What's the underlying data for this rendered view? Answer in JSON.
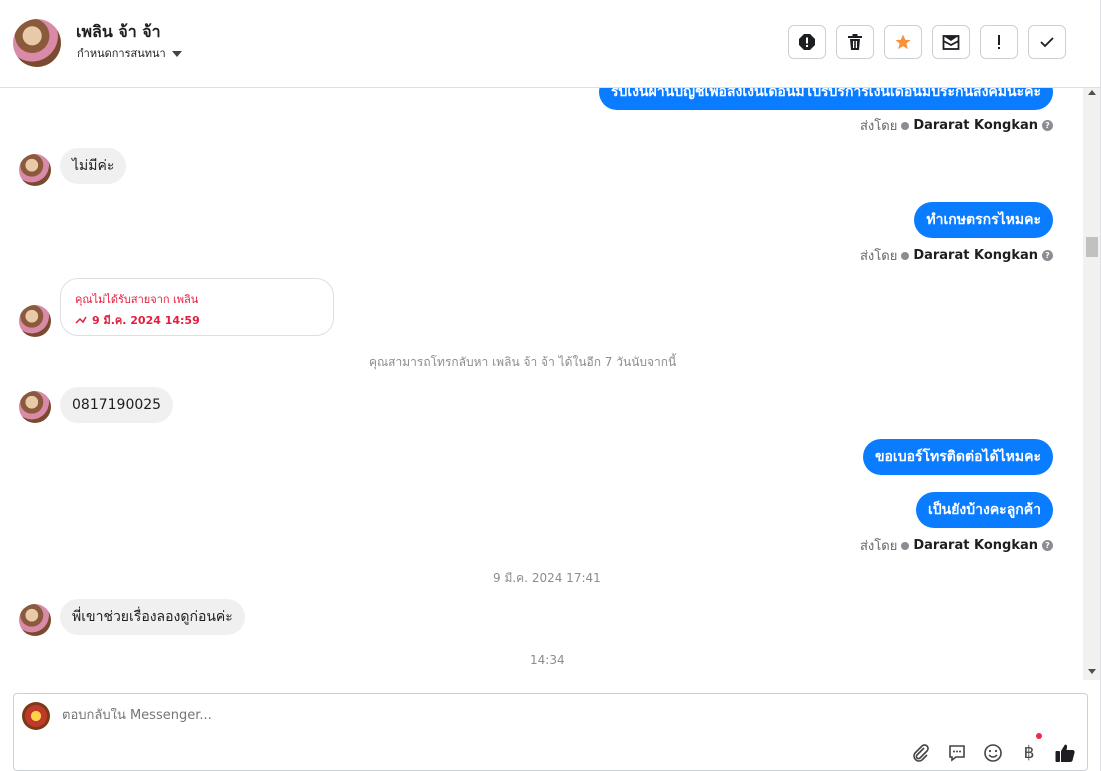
{
  "header": {
    "contact_name": "เพลิน จ้า จ้า",
    "assign_label": "กำหนดการสนทนา",
    "toolbar": [
      {
        "name": "spam-button",
        "icon": "alert-octagon-icon"
      },
      {
        "name": "delete-button",
        "icon": "trash-icon"
      },
      {
        "name": "star-button",
        "icon": "star-icon"
      },
      {
        "name": "mark-unread-button",
        "icon": "envelope-icon"
      },
      {
        "name": "follow-up-button",
        "icon": "exclamation-icon"
      },
      {
        "name": "done-button",
        "icon": "check-icon"
      }
    ]
  },
  "messages": {
    "m0_text": "รับเงินผ่านบัญชีเพื่อส่งเงินเดือนมีโปรบริการเงินเดือนมีประกันสังคมนะคะ",
    "m0_sent_prefix": "ส่งโดย",
    "m0_sent_name": "Dararat Kongkan",
    "m1_text": "ไม่มีค่ะ",
    "m2_text": "ทำเกษตรกรไหมคะ",
    "m2_sent_prefix": "ส่งโดย",
    "m2_sent_name": "Dararat Kongkan",
    "missed_title": "คุณไม่ได้รับสายจาก เพลิน",
    "missed_time": "9 มี.ค. 2024 14:59",
    "callback_notice": "คุณสามารถโทรกลับหา เพลิน จ้า จ้า ได้ในอีก 7 วันนับจากนี้",
    "m3_text": "0817190025",
    "m4_text": "ขอเบอร์โทรติดต่อได้ไหมคะ",
    "m5_text": "เป็นยังบ้างคะลูกค้า",
    "m5_sent_prefix": "ส่งโดย",
    "m5_sent_name": "Dararat Kongkan",
    "timestamp1": "9 มี.ค. 2024 17:41",
    "m6_text": "พี่เขาช่วยเรื่องลองดูก่อนค่ะ",
    "timestamp2": "14:34"
  },
  "composer": {
    "placeholder": "ตอบกลับใน Messenger...",
    "icons": [
      "paperclip-icon",
      "chat-bubble-icon",
      "emoji-icon",
      "baht-icon",
      "thumbs-up-icon"
    ]
  },
  "colors": {
    "accent": "#0a7cff",
    "missed_call": "#e41e3f",
    "star": "#f7923a"
  }
}
